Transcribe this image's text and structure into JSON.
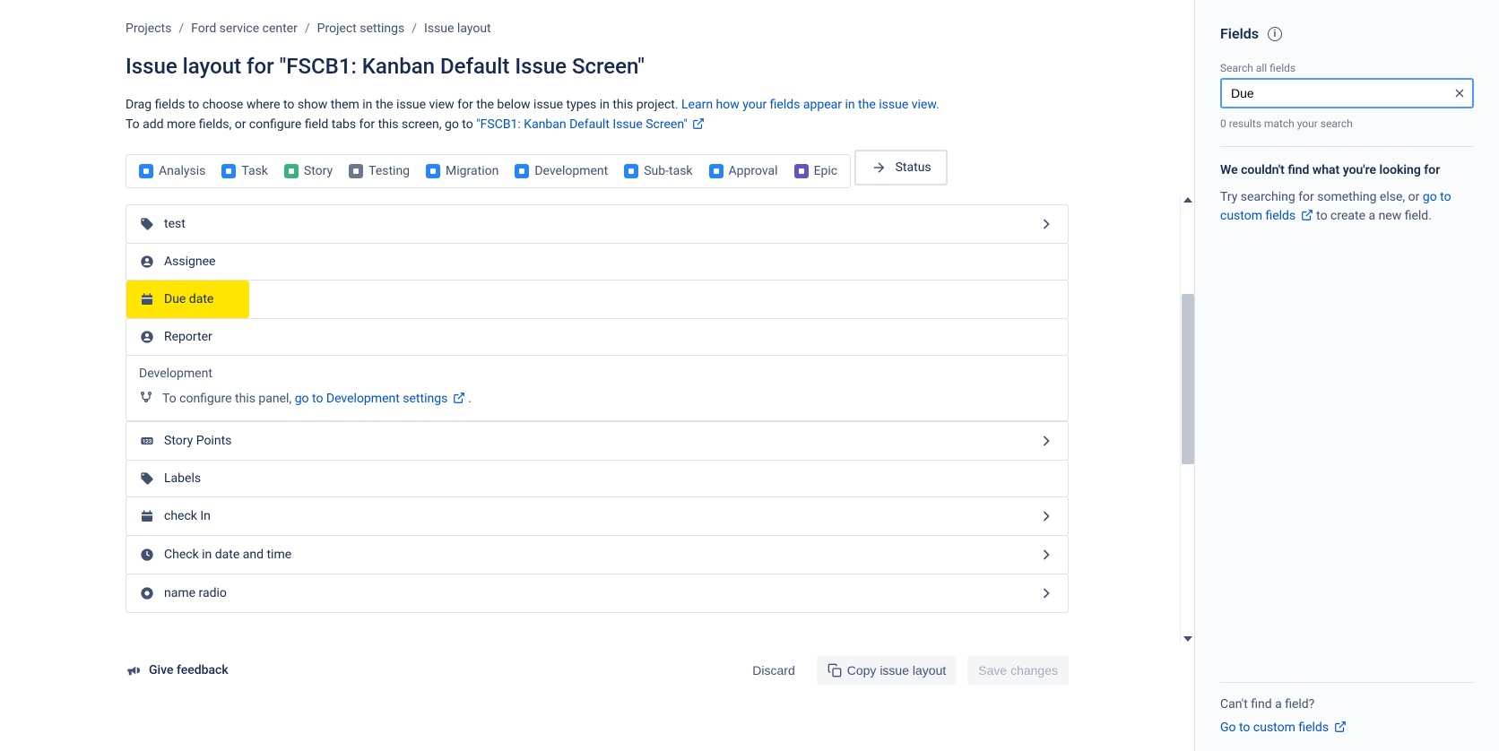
{
  "breadcrumb": {
    "projects": "Projects",
    "project_name": "Ford service center",
    "settings": "Project settings",
    "current": "Issue layout"
  },
  "page_title": "Issue layout for \"FSCB1: Kanban Default Issue Screen\"",
  "desc": {
    "line1_pre": "Drag fields to choose where to show them in the issue view for the below issue types in this project. ",
    "line1_link": "Learn how your fields appear in the issue view.",
    "line2_pre": "To add more fields, or configure field tabs for this screen, go to ",
    "line2_link": "\"FSCB1: Kanban Default Issue Screen\""
  },
  "issue_types": [
    {
      "name": "Analysis",
      "color": "#2684FF"
    },
    {
      "name": "Task",
      "color": "#2684FF"
    },
    {
      "name": "Story",
      "color": "#36B37E"
    },
    {
      "name": "Testing",
      "color": "#6B778C"
    },
    {
      "name": "Migration",
      "color": "#2684FF"
    },
    {
      "name": "Development",
      "color": "#2684FF"
    },
    {
      "name": "Sub-task",
      "color": "#2684FF"
    },
    {
      "name": "Approval",
      "color": "#2684FF"
    },
    {
      "name": "Epic",
      "color": "#6554C0"
    }
  ],
  "status_label": "Status",
  "fields": {
    "test": "test",
    "assignee": "Assignee",
    "due_date": "Due date",
    "reporter": "Reporter",
    "story_points": "Story Points",
    "labels": "Labels",
    "check_in": "check In",
    "check_in_dt": "Check in date and time",
    "name_radio": "name radio"
  },
  "dev_panel": {
    "title": "Development",
    "body_pre": "To configure this panel, ",
    "body_link": "go to Development settings"
  },
  "footer": {
    "feedback": "Give feedback",
    "discard": "Discard",
    "copy": "Copy issue layout",
    "save": "Save changes"
  },
  "sidebar": {
    "title": "Fields",
    "search_label": "Search all fields",
    "search_value": "Due",
    "results_count": "0 results match your search",
    "no_results_title": "We couldn't find what you're looking for",
    "no_results_body_pre": "Try searching for something else, or ",
    "no_results_body_link": "go to custom fields",
    "no_results_body_post": " to create a new field.",
    "footer_q": "Can't find a field?",
    "footer_link": "Go to custom fields"
  }
}
